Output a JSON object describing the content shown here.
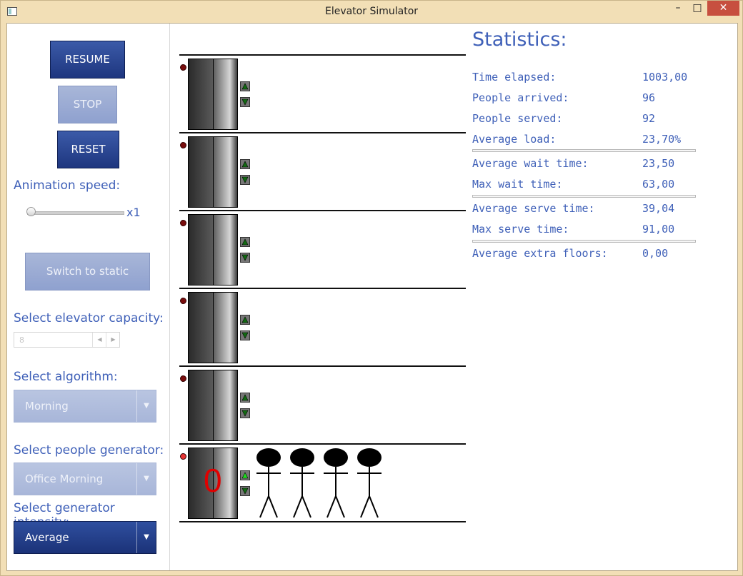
{
  "window": {
    "title": "Elevator Simulator",
    "minimize": "–",
    "maximize": "□",
    "close": "✕"
  },
  "controls": {
    "resume": "RESUME",
    "stop": "STOP",
    "reset": "RESET",
    "animation_speed_label": "Animation speed:",
    "speed_value": "x1",
    "speed_fraction": 0,
    "switch_static": "Switch to static",
    "capacity_label": "Select elevator capacity:",
    "capacity_value": "8",
    "algorithm_label": "Select algorithm:",
    "algorithm_value": "Morning",
    "generator_label": "Select people generator:",
    "generator_value": "Office Morning",
    "intensity_label": "Select generator intensity:",
    "intensity_value": "Average"
  },
  "simulation": {
    "floors": 6,
    "elevator_load": "0",
    "people_waiting_ground": 4
  },
  "stats": {
    "title": "Statistics:",
    "rows": [
      {
        "k": "Time elapsed:",
        "v": "1003,00"
      },
      {
        "k": "People arrived:",
        "v": "96"
      },
      {
        "k": "People served:",
        "v": "92"
      },
      {
        "k": "Average load:",
        "v": "23,70%"
      },
      {
        "k": "Average wait time:",
        "v": "23,50"
      },
      {
        "k": "Max wait time:",
        "v": "63,00"
      },
      {
        "k": "Average serve time:",
        "v": "39,04"
      },
      {
        "k": "Max serve time:",
        "v": "91,00"
      },
      {
        "k": "Average extra floors:",
        "v": "0,00"
      }
    ]
  },
  "colors": {
    "accent": "#3f60b8",
    "button_dark": "#1e367f",
    "button_disabled": "#8fa1cf",
    "load_text": "#e00000",
    "indicator_off": "#7a0d0d",
    "indicator_on": "#e83434",
    "arrow_on": "#1fdc1f",
    "arrow_off": "#126a12"
  }
}
